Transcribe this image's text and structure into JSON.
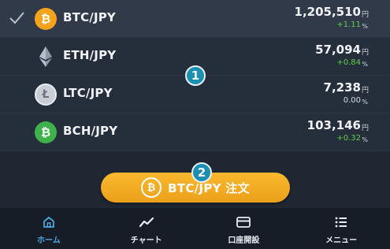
{
  "pairs": [
    {
      "name": "BTC/JPY",
      "price": "1,205,510",
      "unit": "円",
      "change": "+1.11",
      "pct": "%",
      "icon": "bitcoin-icon",
      "selected": true
    },
    {
      "name": "ETH/JPY",
      "price": "57,094",
      "unit": "円",
      "change": "+0.84",
      "pct": "%",
      "icon": "ethereum-icon",
      "selected": false
    },
    {
      "name": "LTC/JPY",
      "price": "7,238",
      "unit": "円",
      "change": "0.00",
      "pct": "%",
      "icon": "litecoin-icon",
      "selected": false
    },
    {
      "name": "BCH/JPY",
      "price": "103,146",
      "unit": "円",
      "change": "+0.32",
      "pct": "%",
      "icon": "bitcoin-cash-icon",
      "selected": false
    }
  ],
  "callouts": {
    "one": "1",
    "two": "2"
  },
  "order_button": {
    "label": "BTC/JPY 注文",
    "coin_symbol": "₿"
  },
  "coin_symbols": {
    "btc": "₿",
    "bch": "₿",
    "ltc": "Ł"
  },
  "tabs": [
    {
      "label": "ホーム",
      "icon": "home-icon",
      "active": true
    },
    {
      "label": "チャート",
      "icon": "chart-icon",
      "active": false
    },
    {
      "label": "口座開設",
      "icon": "card-icon",
      "active": false
    },
    {
      "label": "メニュー",
      "icon": "menu-icon",
      "active": false
    }
  ],
  "colors": {
    "btc": "#f7a21b",
    "bch": "#3fb14a",
    "positive": "#5fcf4a",
    "accent_tab": "#4ea6e0",
    "order_button": "#f5ab22",
    "callout": "#1d8fb0"
  }
}
